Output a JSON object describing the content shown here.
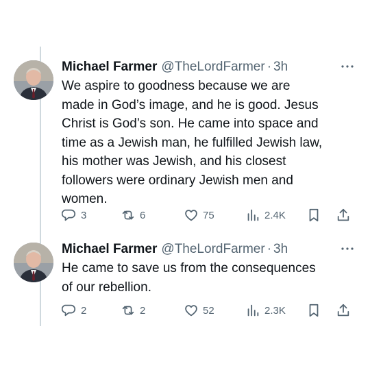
{
  "tweets": [
    {
      "name": "Michael Farmer",
      "handle": "@TheLordFarmer",
      "dot": "·",
      "time": "3h",
      "text": "We aspire to goodness because we are\nmade in God’s image, and he is good. Jesus\nChrist is God’s son. He came into space and\ntime as a Jewish man, he fulfilled Jewish law,\nhis mother was Jewish, and his closest\nfollowers were ordinary Jewish men and\nwomen.",
      "replies": "3",
      "reposts": "6",
      "likes": "75",
      "views": "2.4K"
    },
    {
      "name": "Michael Farmer",
      "handle": "@TheLordFarmer",
      "dot": "·",
      "time": "3h",
      "text": "He came to save us from the consequences\nof our rebellion.",
      "replies": "2",
      "reposts": "2",
      "likes": "52",
      "views": "2.3K"
    }
  ],
  "icons": {
    "more": "more-horizontal-icon",
    "reply": "reply-bubble-icon",
    "repost": "repost-arrows-icon",
    "like": "heart-icon",
    "views": "analytics-bars-icon",
    "bookmark": "bookmark-icon",
    "share": "share-upload-icon"
  },
  "colors": {
    "icon_gray": "#536471",
    "text": "#0f1419",
    "thread_line": "#cfd9de"
  }
}
